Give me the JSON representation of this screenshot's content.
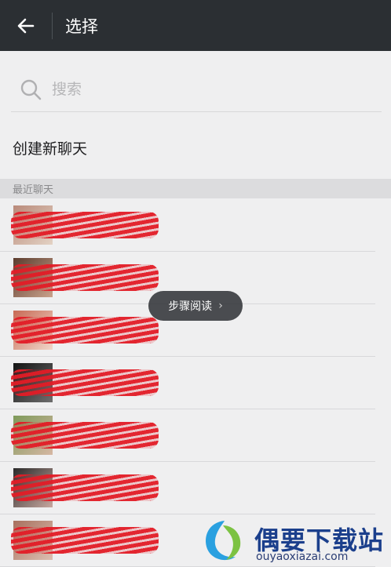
{
  "header": {
    "title": "选择"
  },
  "search": {
    "placeholder": "搜索",
    "value": ""
  },
  "new_chat": {
    "label": "创建新聊天"
  },
  "recent": {
    "header": "最近聊天",
    "items": [
      {
        "name": ""
      },
      {
        "name": ""
      },
      {
        "name": ""
      },
      {
        "name": ""
      },
      {
        "name": ""
      },
      {
        "name": ""
      },
      {
        "name": ""
      }
    ]
  },
  "toast": {
    "label": "步骤阅读"
  },
  "watermark": {
    "brand": "偶要下载站",
    "url": "ouyaoxiazai.com"
  },
  "colors": {
    "topbar": "#2b2f33",
    "background": "#efeff0",
    "section": "#dcdcde",
    "redaction": "#e21c26"
  }
}
